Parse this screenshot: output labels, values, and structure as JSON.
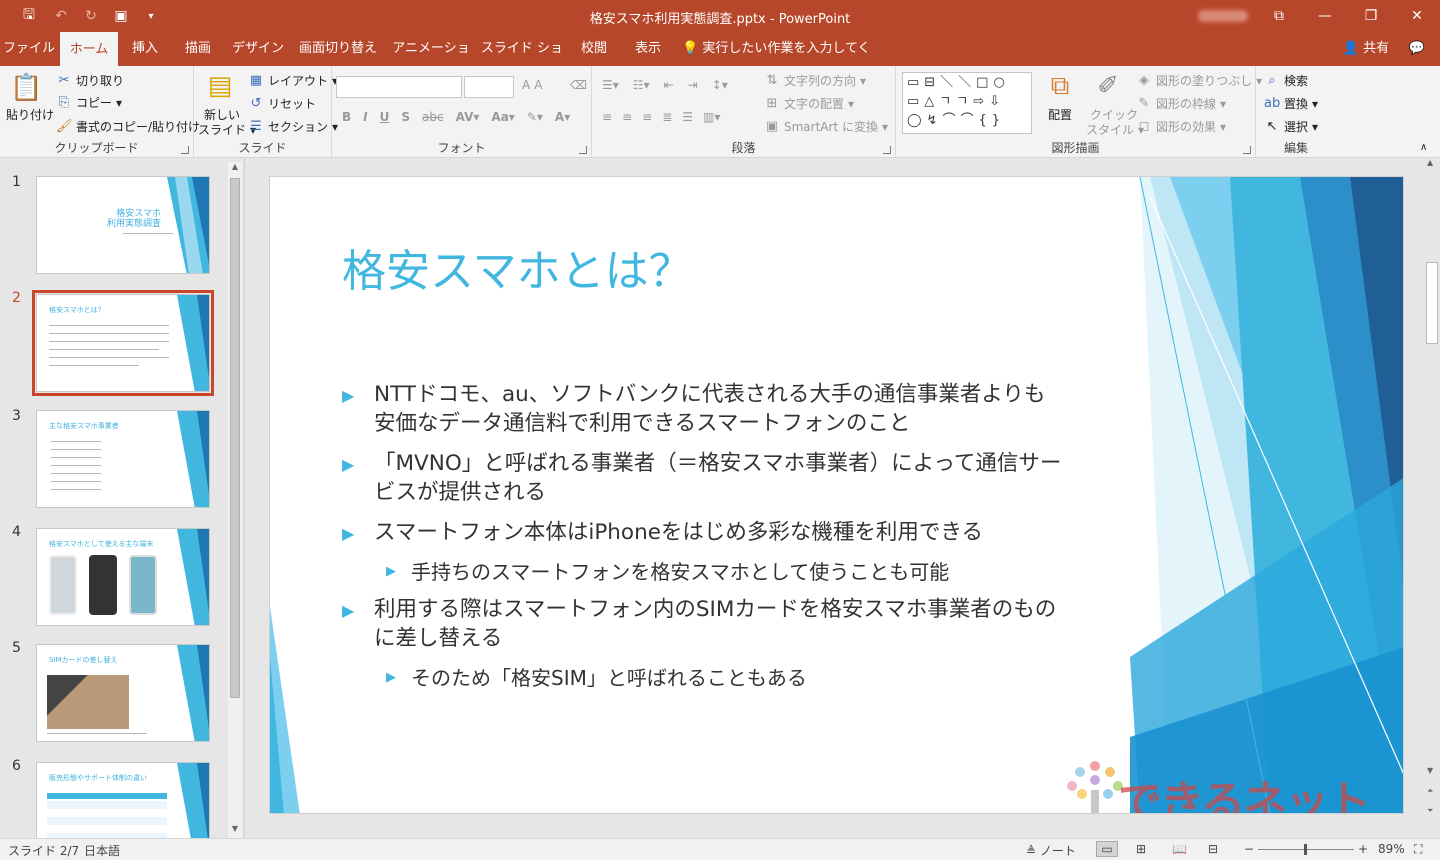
{
  "window": {
    "title": "格安スマホ利用実態調査.pptx  -  PowerPoint",
    "share": "共有"
  },
  "tabs": [
    "ファイル",
    "ホーム",
    "挿入",
    "描画",
    "デザイン",
    "画面切り替え",
    "アニメーション",
    "スライド ショー",
    "校閲",
    "表示"
  ],
  "tell_me": "実行したい作業を入力してください",
  "ribbon": {
    "clipboard": {
      "paste": "貼り付け",
      "cut": "切り取り",
      "copy": "コピー",
      "format_painter": "書式のコピー/貼り付け",
      "label": "クリップボード"
    },
    "slides": {
      "new_slide_1": "新しい",
      "new_slide_2": "スライド",
      "layout": "レイアウト",
      "reset": "リセット",
      "section": "セクション",
      "label": "スライド"
    },
    "font": {
      "label": "フォント"
    },
    "paragraph": {
      "text_direction": "文字列の方向",
      "align_text": "文字の配置",
      "smartart": "SmartArt に変換",
      "label": "段落"
    },
    "drawing": {
      "arrange": "配置",
      "quick_styles_1": "クイック",
      "quick_styles_2": "スタイル",
      "shape_fill": "図形の塗りつぶし",
      "shape_outline": "図形の枠線",
      "shape_effects": "図形の効果",
      "label": "図形描画"
    },
    "editing": {
      "find": "検索",
      "replace": "置換",
      "select": "選択",
      "label": "編集"
    }
  },
  "thumbnails": [
    {
      "num": "1",
      "title": "格安スマホ\n利用実態調査"
    },
    {
      "num": "2",
      "title": "格安スマホとは？"
    },
    {
      "num": "3",
      "title": "主な格安スマホ事業者"
    },
    {
      "num": "4",
      "title": "格安スマホとして使える主な端末"
    },
    {
      "num": "5",
      "title": "SIMカードの差し替え"
    },
    {
      "num": "6",
      "title": "販売形態やサポート体制の違い"
    }
  ],
  "slide": {
    "title": "格安スマホとは？",
    "bullets": [
      {
        "level": 1,
        "lines": [
          "NTTドコモ、au、ソフトバンクに代表される大手の通信事業者よりも",
          "安価なデータ通信料で利用できるスマートフォンのこと"
        ]
      },
      {
        "level": 1,
        "lines": [
          "「MVNO」と呼ばれる事業者（＝格安スマホ事業者）によって通信サー",
          "ビスが提供される"
        ]
      },
      {
        "level": 1,
        "lines": [
          "スマートフォン本体はiPhoneをはじめ多彩な機種を利用できる"
        ]
      },
      {
        "level": 2,
        "lines": [
          "手持ちのスマートフォンを格安スマホとして使うことも可能"
        ]
      },
      {
        "level": 1,
        "lines": [
          "利用する際はスマートフォン内のSIMカードを格安スマホ事業者のもの",
          "に差し替える"
        ]
      },
      {
        "level": 2,
        "lines": [
          "そのため「格安SIM」と呼ばれることもある"
        ]
      }
    ],
    "watermark": "できるネット"
  },
  "status": {
    "slide": "スライド 2/7",
    "language": "日本語",
    "notes": "ノート",
    "zoom": "89%"
  },
  "colors": {
    "accent": "#b7472a",
    "slide_title": "#41b7e0"
  }
}
